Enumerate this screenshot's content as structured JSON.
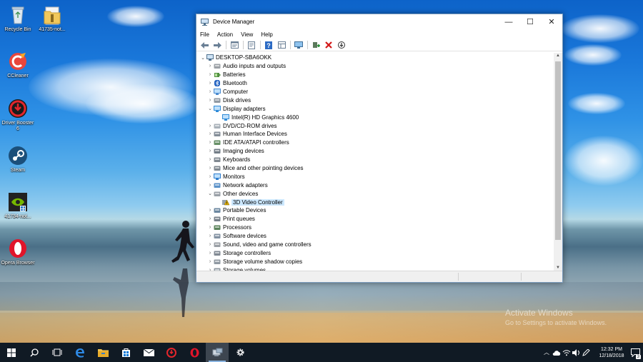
{
  "desktop": {
    "icons": [
      {
        "label": "Recycle Bin",
        "icon": "recycle-bin-icon"
      },
      {
        "label": "41735-not...",
        "icon": "folder-icon"
      },
      {
        "label": "CCleaner",
        "icon": "ccleaner-icon"
      },
      {
        "label": "Driver Booster 6",
        "icon": "driver-booster-icon"
      },
      {
        "label": "Steam",
        "icon": "steam-icon"
      },
      {
        "label": "41734-not...",
        "icon": "nvidia-icon"
      },
      {
        "label": "Opera Browser",
        "icon": "opera-icon"
      }
    ],
    "watermark": {
      "line1": "Activate Windows",
      "line2": "Go to Settings to activate Windows."
    }
  },
  "window": {
    "title": "Device Manager",
    "controls": {
      "minimize": "—",
      "maximize": "☐",
      "close": "✕"
    },
    "menu": [
      "File",
      "Action",
      "View",
      "Help"
    ],
    "toolbar": [
      "back-icon",
      "forward-icon",
      "properties-icon",
      "update-icon",
      "help-icon",
      "view-icon",
      "monitor-icon",
      "add-driver-icon",
      "uninstall-icon",
      "download-icon"
    ],
    "tree": {
      "root": "DESKTOP-SBA6OKK",
      "items": [
        {
          "label": "Audio inputs and outputs",
          "level": 1,
          "expander": "›",
          "icon": "audio"
        },
        {
          "label": "Batteries",
          "level": 1,
          "expander": "›",
          "icon": "battery"
        },
        {
          "label": "Bluetooth",
          "level": 1,
          "expander": "›",
          "icon": "bluetooth"
        },
        {
          "label": "Computer",
          "level": 1,
          "expander": "›",
          "icon": "computer"
        },
        {
          "label": "Disk drives",
          "level": 1,
          "expander": "›",
          "icon": "disk"
        },
        {
          "label": "Display adapters",
          "level": 1,
          "expander": "⌄",
          "icon": "display"
        },
        {
          "label": "Intel(R) HD Graphics 4600",
          "level": 2,
          "expander": "",
          "icon": "display"
        },
        {
          "label": "DVD/CD-ROM drives",
          "level": 1,
          "expander": "›",
          "icon": "dvd"
        },
        {
          "label": "Human Interface Devices",
          "level": 1,
          "expander": "›",
          "icon": "hid"
        },
        {
          "label": "IDE ATA/ATAPI controllers",
          "level": 1,
          "expander": "›",
          "icon": "ide"
        },
        {
          "label": "Imaging devices",
          "level": 1,
          "expander": "›",
          "icon": "camera"
        },
        {
          "label": "Keyboards",
          "level": 1,
          "expander": "›",
          "icon": "keyboard"
        },
        {
          "label": "Mice and other pointing devices",
          "level": 1,
          "expander": "›",
          "icon": "mouse"
        },
        {
          "label": "Monitors",
          "level": 1,
          "expander": "›",
          "icon": "monitor"
        },
        {
          "label": "Network adapters",
          "level": 1,
          "expander": "›",
          "icon": "network"
        },
        {
          "label": "Other devices",
          "level": 1,
          "expander": "⌄",
          "icon": "other"
        },
        {
          "label": "3D Video Controller",
          "level": 2,
          "expander": "",
          "icon": "warning",
          "selected": true
        },
        {
          "label": "Portable Devices",
          "level": 1,
          "expander": "›",
          "icon": "portable"
        },
        {
          "label": "Print queues",
          "level": 1,
          "expander": "›",
          "icon": "printer"
        },
        {
          "label": "Processors",
          "level": 1,
          "expander": "›",
          "icon": "cpu"
        },
        {
          "label": "Software devices",
          "level": 1,
          "expander": "›",
          "icon": "software"
        },
        {
          "label": "Sound, video and game controllers",
          "level": 1,
          "expander": "›",
          "icon": "audio"
        },
        {
          "label": "Storage controllers",
          "level": 1,
          "expander": "›",
          "icon": "storage"
        },
        {
          "label": "Storage volume shadow copies",
          "level": 1,
          "expander": "›",
          "icon": "disk"
        },
        {
          "label": "Storage volumes",
          "level": 1,
          "expander": "›",
          "icon": "disk"
        }
      ]
    }
  },
  "taskbar": {
    "apps": [
      "start-icon",
      "search-icon",
      "task-view-icon",
      "edge-icon",
      "file-explorer-icon",
      "store-icon",
      "mail-icon",
      "driver-booster-icon",
      "opera-icon",
      "device-manager-icon",
      "settings-icon"
    ],
    "clock": {
      "time": "12:32 PM",
      "date": "12/18/2018"
    },
    "notifications": "3"
  },
  "colors": {
    "accent": "#0078d7",
    "selection": "#cce8ff",
    "taskbar": "#101a24"
  }
}
